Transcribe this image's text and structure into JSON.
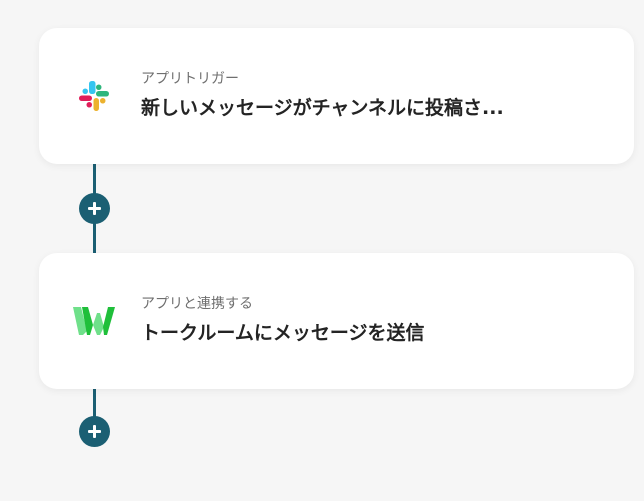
{
  "flow": {
    "steps": [
      {
        "label": "アプリトリガー",
        "title": "新しいメッセージがチャンネルに投稿さ...",
        "icon": "slack-logo-icon"
      },
      {
        "label": "アプリと連携する",
        "title": "トークルームにメッセージを送信",
        "icon": "lineworks-w-logo-icon"
      }
    ],
    "add_buttons": [
      {
        "icon": "plus-icon"
      },
      {
        "icon": "plus-icon"
      }
    ]
  },
  "colors": {
    "background": "#f6f6f6",
    "card": "#ffffff",
    "connector": "#1b5f73",
    "label_text": "#6f6f6f",
    "title_text": "#242424",
    "slack_blue": "#36C5F0",
    "slack_green": "#2EB67D",
    "slack_red": "#E01E5A",
    "slack_yellow": "#ECB22E",
    "w_logo_dark": "#1fbf3a",
    "w_logo_light": "#6fe08a"
  }
}
